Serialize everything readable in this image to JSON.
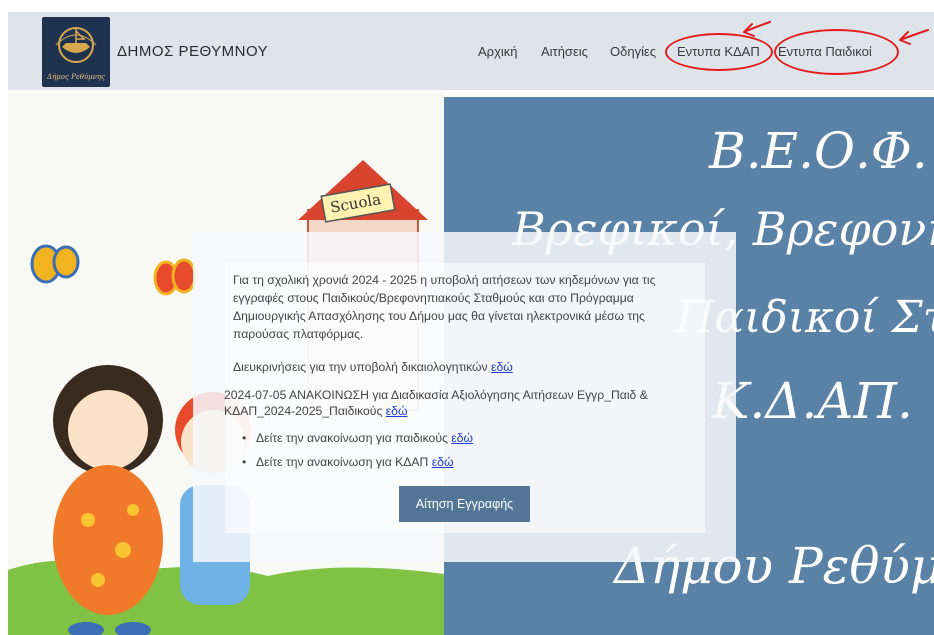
{
  "header": {
    "site_title": "ΔΗΜΟΣ ΡΕΘΥΜΝΟΥ",
    "logo_caption": "Δήμος Ρεθύμνης",
    "nav": [
      "Αρχική",
      "Αιτήσεις",
      "Οδηγίες",
      "Εντυπα ΚΔΑΠ",
      "Εντυπα Παιδικοί"
    ]
  },
  "hero": {
    "right_lines": [
      "Β.Ε.Ο.Φ.",
      "Βρεφικοί, Βρεφονη",
      "Παιδικοί Στα",
      "Κ.Δ.ΑΠ.",
      "Δήμου Ρεθύμ"
    ],
    "sign_text": "Scuola"
  },
  "content": {
    "intro": "Για τη σχολική χρονιά 2024 - 2025 η υποβολή αιτήσεων των κηδεμόνων για τις εγγραφές στους Παιδικούς/Βρεφονηπιακούς Σταθμούς και στο Πρόγραμμα Δημιουργικής Απασχόλησης του Δήμου μας θα γίνεται ηλεκτρονικά μέσω της παρούσας πλατφόρμας.",
    "clarif_text": "Διευκρινήσεις για την υποβολή δικαιολογητικών",
    "link_label": "εδώ",
    "announcement": "2024-07-05 ΑΝΑΚΟΙΝΩΣΗ για Διαδικασία Αξιολόγησης Αιτήσεων Εγγρ_Παιδ & ΚΔΑΠ_2024-2025_Παιδικούς",
    "bullet_kids": "Δείτε την ανακοίνωση για παιδικούς",
    "bullet_kdap": "Δείτε την ανακοίνωση για ΚΔΑΠ",
    "apply_button": "Αίτηση Εγγραφής"
  },
  "colors": {
    "header_bg": "#dfe3ea",
    "panel_blue": "#5a82a6",
    "button": "#537597",
    "annotation_red": "#e21c1c",
    "link": "#1a3fd0"
  }
}
